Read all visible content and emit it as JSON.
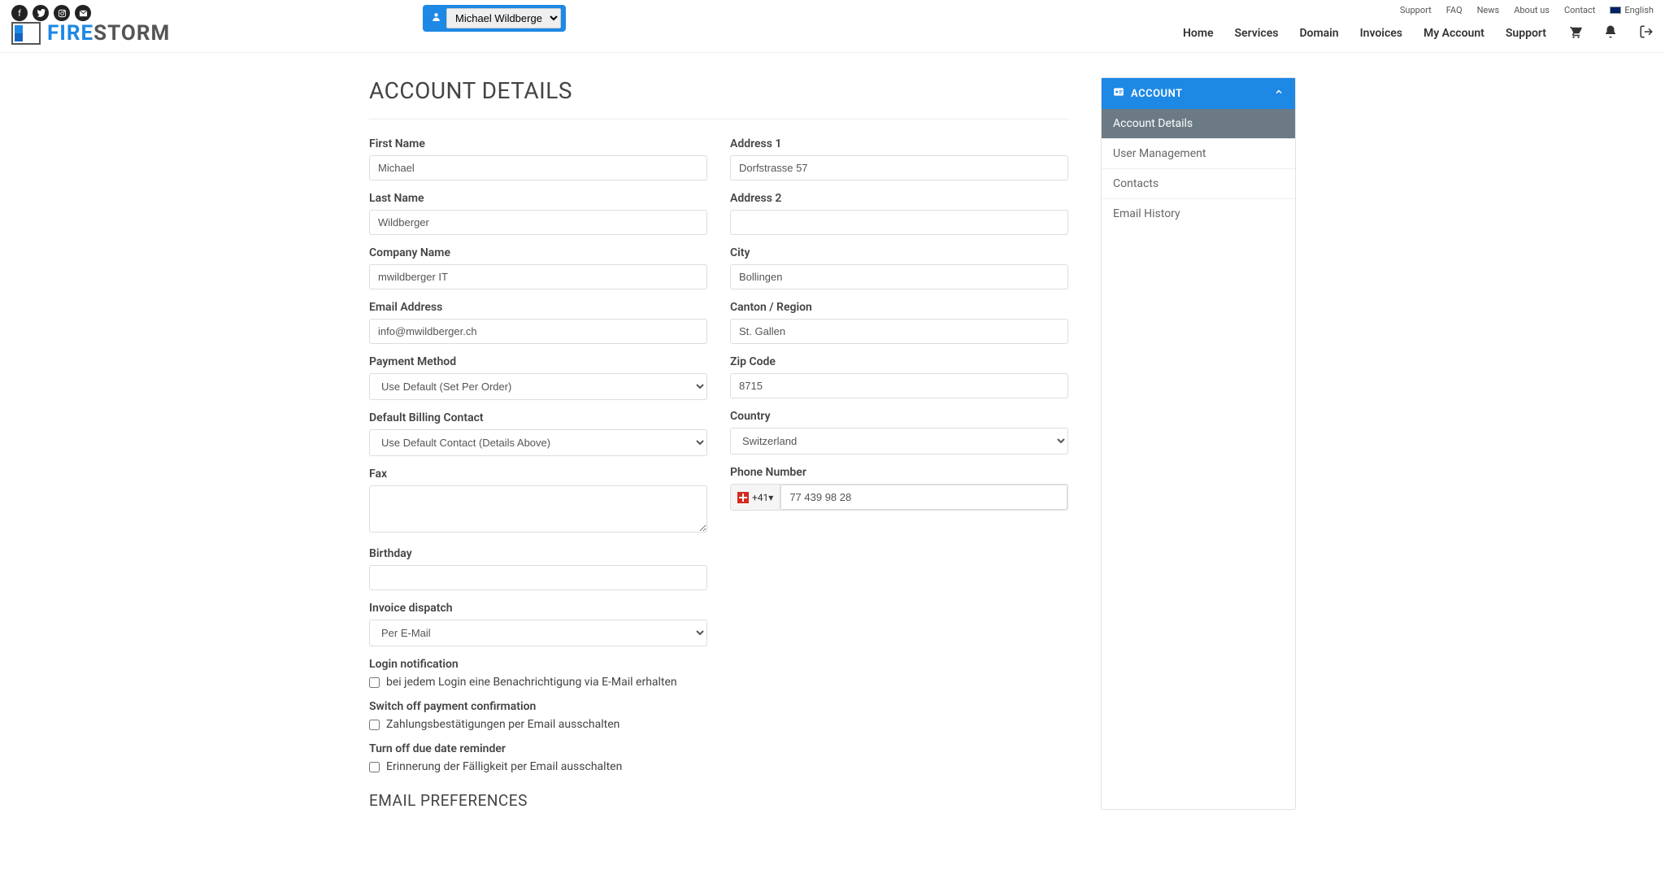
{
  "topLinks": {
    "support": "Support",
    "faq": "FAQ",
    "news": "News",
    "about": "About us",
    "contact": "Contact",
    "lang": "English"
  },
  "logo": {
    "fire": "FIRE",
    "storm": "STORM"
  },
  "userSelect": {
    "value": "Michael Wildberge"
  },
  "mainNav": {
    "home": "Home",
    "services": "Services",
    "domain": "Domain",
    "invoices": "Invoices",
    "myAccount": "My Account",
    "support": "Support"
  },
  "page": {
    "title": "ACCOUNT DETAILS",
    "emailPrefs": "EMAIL PREFERENCES"
  },
  "labels": {
    "firstName": "First Name",
    "lastName": "Last Name",
    "companyName": "Company Name",
    "emailAddress": "Email Address",
    "paymentMethod": "Payment Method",
    "defaultBilling": "Default Billing Contact",
    "fax": "Fax",
    "birthday": "Birthday",
    "invoiceDispatch": "Invoice dispatch",
    "loginNotification": "Login notification",
    "loginNotificationCheck": "bei jedem Login eine Benachrichtigung via E-Mail erhalten",
    "switchOffPayment": "Switch off payment confirmation",
    "switchOffPaymentCheck": "Zahlungsbestätigungen per Email ausschalten",
    "turnOffDue": "Turn off due date reminder",
    "turnOffDueCheck": "Erinnerung der Fälligkeit per Email ausschalten",
    "address1": "Address 1",
    "address2": "Address 2",
    "city": "City",
    "canton": "Canton / Region",
    "zip": "Zip Code",
    "country": "Country",
    "phone": "Phone Number"
  },
  "values": {
    "firstName": "Michael",
    "lastName": "Wildberger",
    "companyName": "mwildberger IT",
    "emailAddress": "info@mwildberger.ch",
    "paymentMethod": "Use Default (Set Per Order)",
    "defaultBilling": "Use Default Contact (Details Above)",
    "fax": "",
    "birthday": "",
    "invoiceDispatch": "Per E-Mail",
    "address1": "Dorfstrasse 57",
    "address2": "",
    "city": "Bollingen",
    "canton": "St. Gallen",
    "zip": "8715",
    "country": "Switzerland",
    "phonePrefix": "+41",
    "phoneNumber": "77 439 98 28"
  },
  "sidePanel": {
    "header": "ACCOUNT",
    "items": {
      "details": "Account Details",
      "userMgmt": "User Management",
      "contacts": "Contacts",
      "emailHistory": "Email History"
    }
  }
}
